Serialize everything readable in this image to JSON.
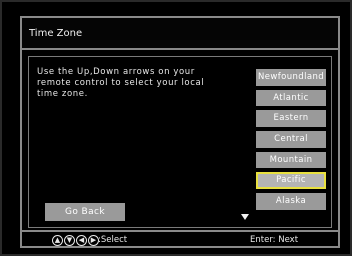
{
  "header": {
    "title": "Time Zone"
  },
  "instructions": {
    "line1": "Use the Up,Down arrows on your",
    "line2": "remote control to select your local",
    "line3": "time zone."
  },
  "zones": [
    {
      "label": "Newfoundland",
      "selected": false
    },
    {
      "label": "Atlantic",
      "selected": false
    },
    {
      "label": "Eastern",
      "selected": false
    },
    {
      "label": "Central",
      "selected": false
    },
    {
      "label": "Mountain",
      "selected": false
    },
    {
      "label": "Pacific",
      "selected": true
    },
    {
      "label": "Alaska",
      "selected": false
    }
  ],
  "go_back_label": "Go Back",
  "footer": {
    "select_label": ":Select",
    "enter_label": "Enter: Next",
    "nav_icons": [
      "up-arrow-icon",
      "down-arrow-icon",
      "left-arrow-icon",
      "right-arrow-icon"
    ]
  },
  "colors": {
    "background": "#000000",
    "button": "#9a9a9a",
    "selected_border": "#e8e040",
    "text": "#f0f0f0"
  }
}
